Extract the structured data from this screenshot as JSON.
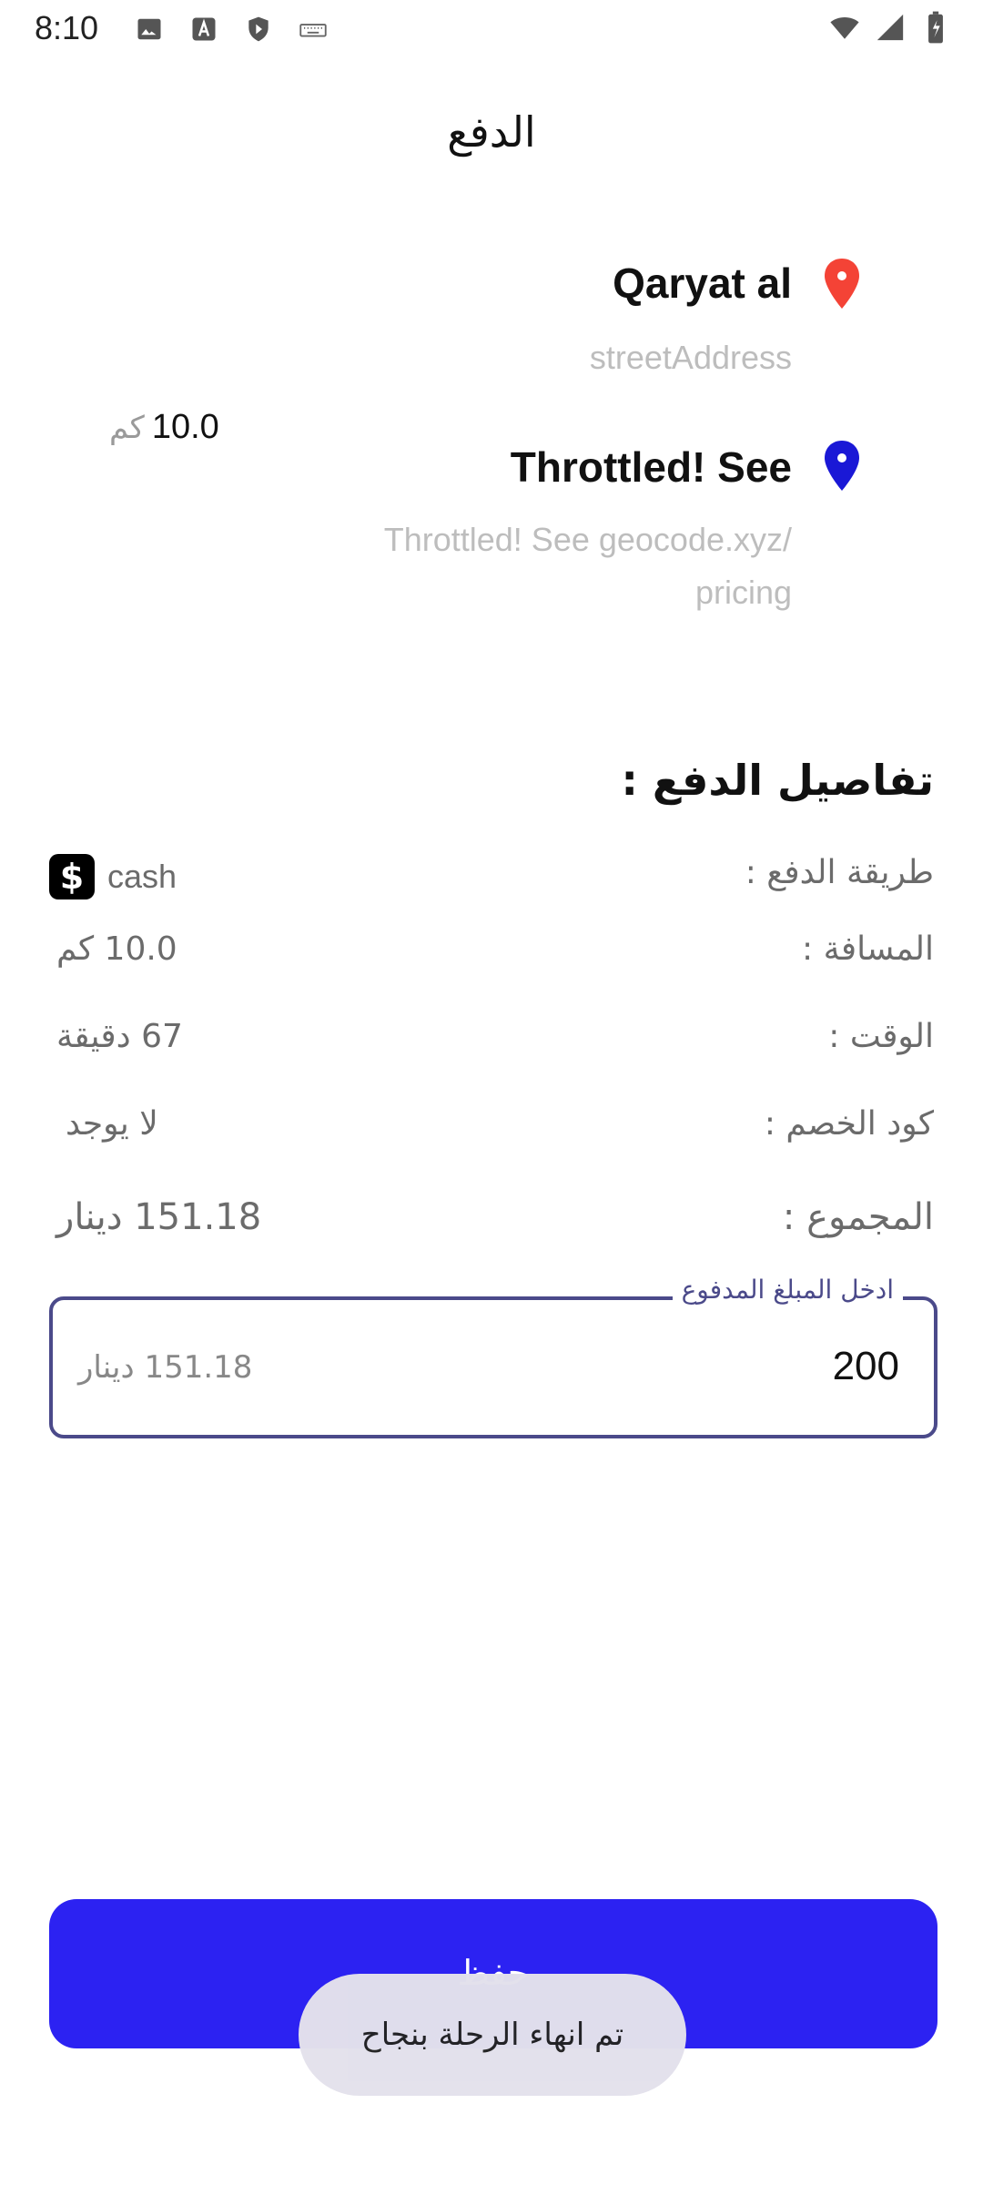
{
  "status_bar": {
    "time": "8:10",
    "icons": [
      "image-icon",
      "a-icon",
      "shield-icon",
      "keyboard-icon",
      "wifi-icon",
      "signal-icon",
      "battery-icon"
    ]
  },
  "header": {
    "title": "الدفع"
  },
  "pickup": {
    "title": "Qaryat al",
    "address": "streetAddress",
    "pin_color": "#f44336"
  },
  "dropoff": {
    "title": "Throttled! See",
    "address_line1": "Throttled! See geocode.xyz/",
    "address_line2": "pricing",
    "pin_color": "#1a18d6"
  },
  "trip_distance": {
    "value": "10.0",
    "unit": "كم"
  },
  "payment_details": {
    "title": "تفاصيل الدفع :",
    "method_label": "طريقة الدفع :",
    "method_value": "cash",
    "distance_label": "المسافة :",
    "distance_value": "10.0 كم",
    "time_label": "الوقت :",
    "time_value": "67 دقيقة",
    "discount_label": "كود الخصم :",
    "discount_value": "لا يوجد",
    "total_label": "المجموع :",
    "total_value": "151.18 دينار"
  },
  "amount_input": {
    "legend": "ادخل المبلغ المدفوع",
    "value": "200",
    "hint": "151.18 دينار"
  },
  "save_button": {
    "label": "حفظ",
    "color": "#2c22f2"
  },
  "toast": {
    "message": "تم انهاء الرحلة بنجاح"
  }
}
